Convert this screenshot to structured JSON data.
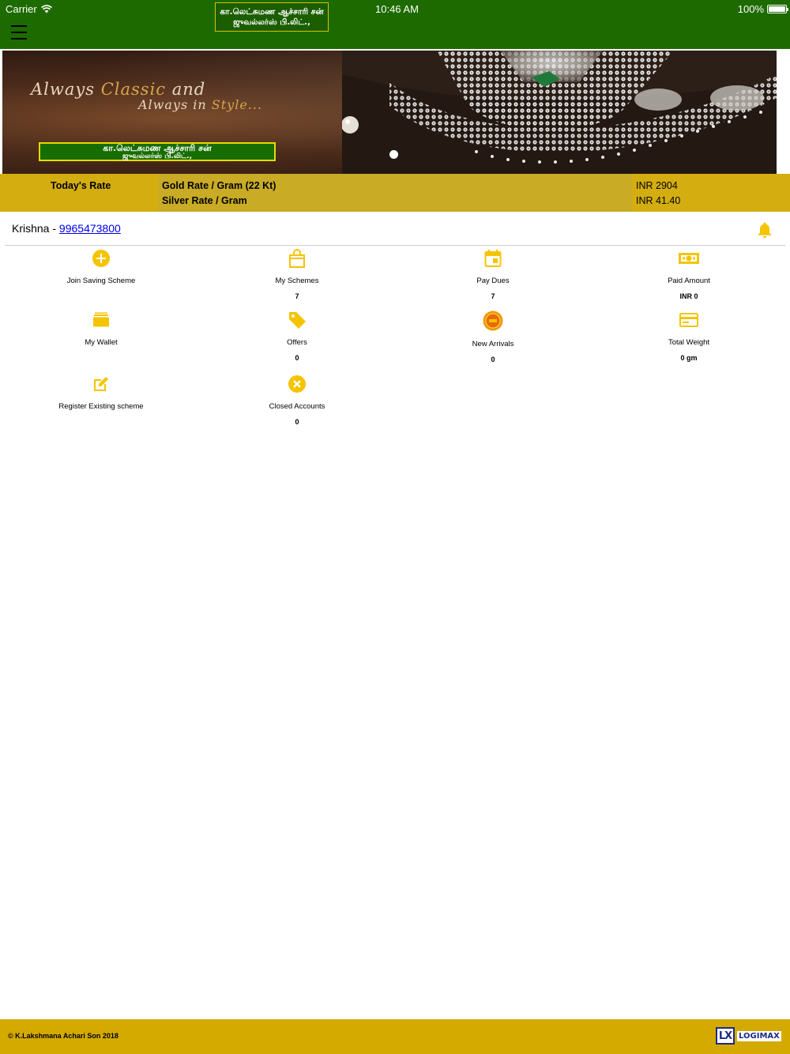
{
  "status_bar": {
    "carrier": "Carrier",
    "time": "10:46 AM",
    "battery": "100%"
  },
  "header": {
    "logo_line1": "கா.லெட்சுமண ஆச்சாரி சன்",
    "logo_line2": "ஜுவல்லர்ஸ் பி.லிட்.,",
    "menu_icon": "hamburger-menu-icon"
  },
  "banner": {
    "tagline_word1": "Always",
    "tagline_word2": "Classic",
    "tagline_word3": "and",
    "tagline_line2a": "Always in",
    "tagline_line2b": "Style...",
    "logo_line1": "கா.லெட்சுமண ஆச்சாரி சன்",
    "logo_line2": "ஜுவல்லர்ஸ் பி.லிட்.,"
  },
  "rates": {
    "label": "Today's Rate",
    "items": [
      {
        "name": "Gold Rate / Gram (22 Kt)",
        "value": "INR 2904"
      },
      {
        "name": "Silver Rate / Gram",
        "value": "INR 41.40"
      }
    ]
  },
  "user": {
    "name": "Krishna - ",
    "phone": "9965473800"
  },
  "tiles": [
    {
      "label": "Join Saving Scheme",
      "value": "",
      "icon": "plus-circle-icon"
    },
    {
      "label": "My Schemes",
      "value": "7",
      "icon": "shopping-bag-icon"
    },
    {
      "label": "Pay Dues",
      "value": "7",
      "icon": "calendar-icon"
    },
    {
      "label": "Paid Amount",
      "value": "INR 0",
      "icon": "cash-icon"
    },
    {
      "label": "My Wallet",
      "value": "",
      "icon": "wallet-icon"
    },
    {
      "label": "Offers",
      "value": "0",
      "icon": "tag-icon"
    },
    {
      "label": "New Arrivals",
      "value": "0",
      "icon": "new-badge-icon"
    },
    {
      "label": "Total Weight",
      "value": "0 gm",
      "icon": "card-icon"
    },
    {
      "label": "Register Existing scheme",
      "value": "",
      "icon": "edit-icon"
    },
    {
      "label": "Closed Accounts",
      "value": "0",
      "icon": "close-circle-icon"
    }
  ],
  "footer": {
    "copyright": "© K.Lakshmana Achari Son 2018",
    "brand_mark": "LX",
    "brand_name": "LOGIMAX"
  },
  "colors": {
    "header_green": "#1d6b00",
    "gold": "#d4aa00",
    "icon_yellow": "#f5c400"
  }
}
